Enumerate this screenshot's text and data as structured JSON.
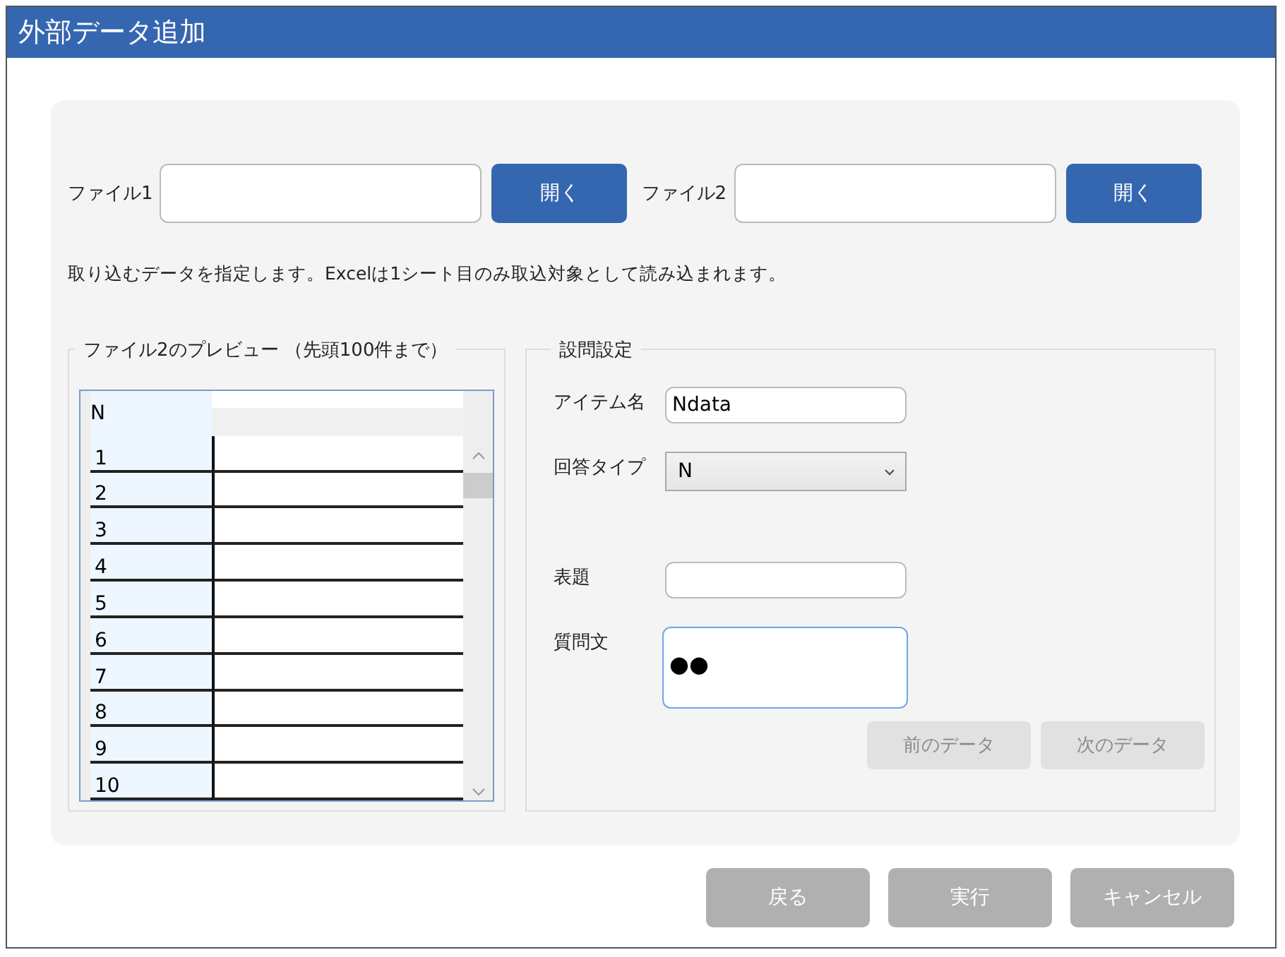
{
  "window": {
    "title": "外部データ追加"
  },
  "files": [
    {
      "label": "ファイル1",
      "button": "開く"
    },
    {
      "label": "ファイル2",
      "button": "開く"
    }
  ],
  "instruction": "取り込むデータを指定します。Excelは1シート目のみ取込対象として読み込まれます。",
  "preview": {
    "title": "ファイル2のプレビュー （先頭100件まで）",
    "header": "N",
    "rows": [
      "1",
      "2",
      "3",
      "4",
      "5",
      "6",
      "7",
      "8",
      "9",
      "10"
    ]
  },
  "question_settings": {
    "title": "設問設定",
    "fields": [
      {
        "kind": "text",
        "label": "アイテム名",
        "value": "Ndata",
        "focused": false
      },
      {
        "kind": "select",
        "label": "回答タイプ",
        "value": "N",
        "focused": false
      },
      {
        "kind": "spacer"
      },
      {
        "kind": "text",
        "label": "表題",
        "focused": false
      },
      {
        "kind": "textarea",
        "label": "質問文",
        "value": "●●",
        "focused": true
      }
    ],
    "buttons": [
      {
        "label": "前のデータ",
        "disabled": true
      },
      {
        "label": "次のデータ",
        "disabled": true
      }
    ]
  },
  "footer_buttons": [
    {
      "label": "戻る"
    },
    {
      "label": "実行"
    },
    {
      "label": "キャンセル"
    }
  ]
}
